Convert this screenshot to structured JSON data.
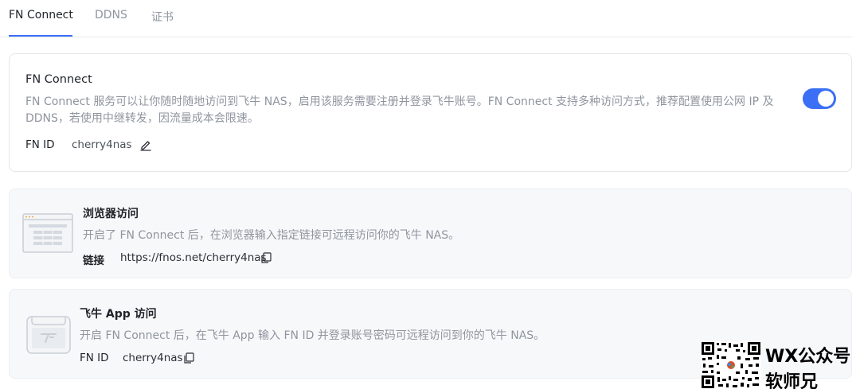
{
  "tabs": [
    {
      "label": "FN Connect",
      "active": true
    },
    {
      "label": "DDNS",
      "active": false
    },
    {
      "label": "证书",
      "active": false
    }
  ],
  "fn_connect": {
    "title": "FN Connect",
    "description_line1": "FN Connect 服务可以让你随时随地访问到飞牛 NAS，启用该服务需要注册并登录飞牛账号。FN Connect 支持多种访问方式，推荐配置使用公网 IP 及",
    "description_line2": "DDNS，若使用中继转发，因流量成本会限速。",
    "id_label": "FN ID",
    "id_value": "cherry4nas",
    "toggle_on": true,
    "edit_icon": "pencil-icon"
  },
  "browser_access": {
    "title": "浏览器访问",
    "description": "开启了 FN Connect 后，在浏览器输入指定链接可远程访问你的飞牛 NAS。",
    "link_label": "链接",
    "link_value": "https://fnos.net/cherry4nas",
    "copy_icon": "copy-icon"
  },
  "app_access": {
    "title": "飞牛 App 访问",
    "description": "开启 FN Connect 后，在飞牛 App 输入 FN ID 并登录账号密码可远程访问到你的飞牛 NAS。",
    "id_label": "FN ID",
    "id_value": "cherry4nas",
    "copy_icon": "copy-icon"
  },
  "watermark": {
    "line1": "WX公众号",
    "line2": "软师兄"
  },
  "colors": {
    "accent": "#3b6ff5",
    "muted_text": "#8f959e",
    "card_gray": "#f7f8fa"
  }
}
